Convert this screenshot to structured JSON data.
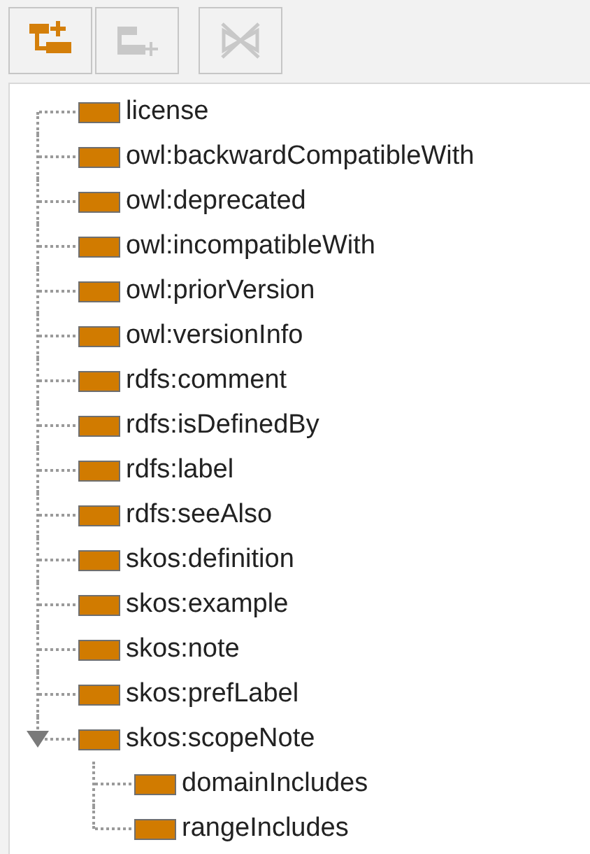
{
  "toolbar": [
    {
      "kind": "add-child",
      "disabled": false
    },
    {
      "kind": "add-sibling",
      "disabled": true
    },
    {
      "kind": "delete",
      "disabled": true
    }
  ],
  "tree": [
    {
      "label": "license"
    },
    {
      "label": "owl:backwardCompatibleWith"
    },
    {
      "label": "owl:deprecated"
    },
    {
      "label": "owl:incompatibleWith"
    },
    {
      "label": "owl:priorVersion"
    },
    {
      "label": "owl:versionInfo"
    },
    {
      "label": "rdfs:comment"
    },
    {
      "label": "rdfs:isDefinedBy"
    },
    {
      "label": "rdfs:label"
    },
    {
      "label": "rdfs:seeAlso"
    },
    {
      "label": "skos:definition"
    },
    {
      "label": "skos:example"
    },
    {
      "label": "skos:note"
    },
    {
      "label": "skos:prefLabel"
    },
    {
      "label": "skos:scopeNote",
      "expanded": true,
      "children": [
        {
          "label": "domainIncludes"
        },
        {
          "label": "rangeIncludes"
        }
      ]
    }
  ]
}
